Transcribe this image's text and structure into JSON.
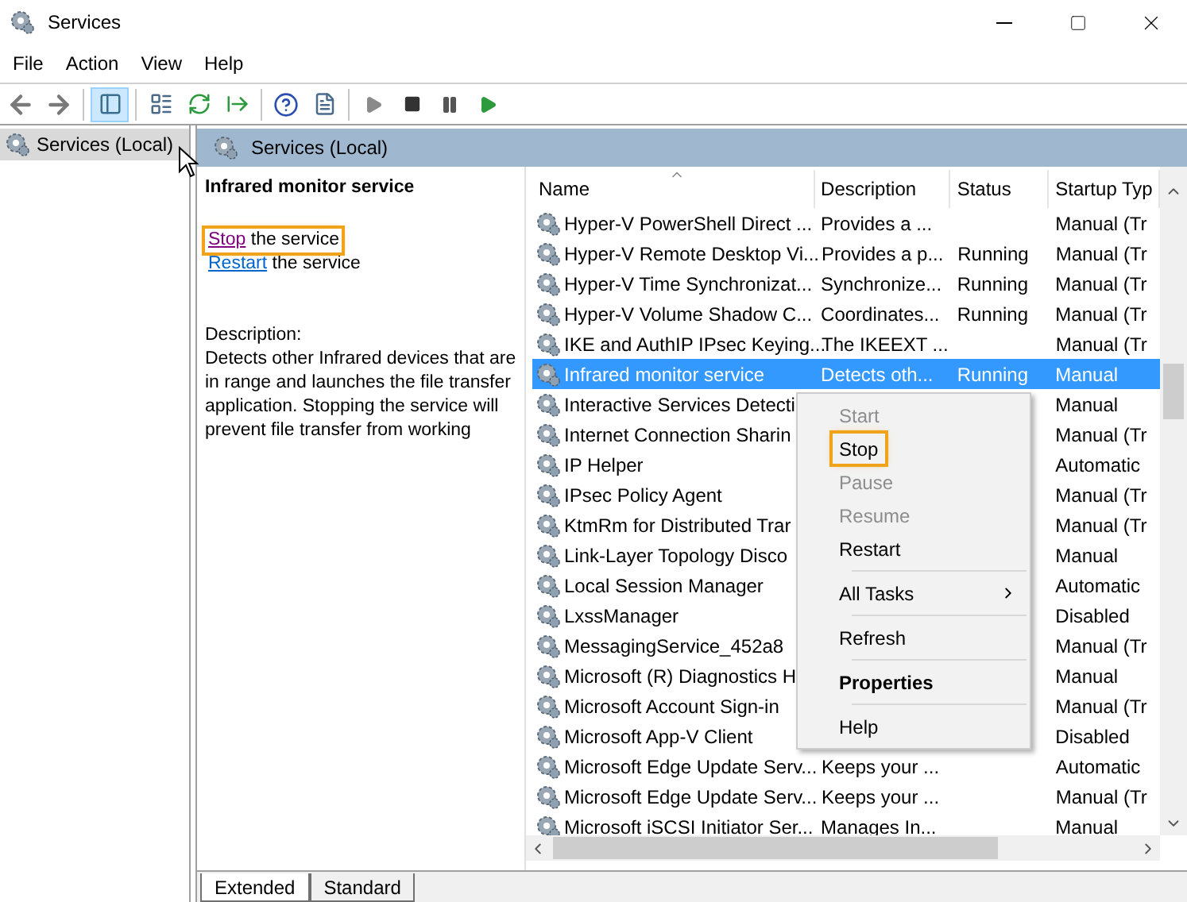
{
  "window": {
    "title": "Services"
  },
  "menu_bar": [
    "File",
    "Action",
    "View",
    "Help"
  ],
  "tree": {
    "items": [
      {
        "label": "Services (Local)",
        "selected": true
      }
    ]
  },
  "panel_header": "Services (Local)",
  "details": {
    "title": "Infrared monitor service",
    "actions": [
      {
        "link": "Stop",
        "rest": "the service",
        "highlighted": true
      },
      {
        "link": "Restart",
        "rest": "the service",
        "highlighted": false
      }
    ],
    "description_label": "Description:",
    "description": "Detects other Infrared devices that are in range and launches the file transfer application. Stopping the service will prevent file transfer from working"
  },
  "table": {
    "columns": [
      "Name",
      "Description",
      "Status",
      "Startup Typ"
    ],
    "rows": [
      {
        "name": "Hyper-V PowerShell Direct ...",
        "description": "Provides a ...",
        "status": "",
        "startup": "Manual (Tr",
        "selected": false
      },
      {
        "name": "Hyper-V Remote Desktop Vi...",
        "description": "Provides a p...",
        "status": "Running",
        "startup": "Manual (Tr",
        "selected": false
      },
      {
        "name": "Hyper-V Time Synchronizat...",
        "description": "Synchronize...",
        "status": "Running",
        "startup": "Manual (Tr",
        "selected": false
      },
      {
        "name": "Hyper-V Volume Shadow C...",
        "description": "Coordinates...",
        "status": "Running",
        "startup": "Manual (Tr",
        "selected": false
      },
      {
        "name": "IKE and AuthIP IPsec Keying...",
        "description": "The IKEEXT ...",
        "status": "",
        "startup": "Manual (Tr",
        "selected": false
      },
      {
        "name": "Infrared monitor service",
        "description": "Detects oth...",
        "status": "Running",
        "startup": "Manual",
        "selected": true
      },
      {
        "name": "Interactive Services Detecti",
        "description": "",
        "status": "",
        "startup": "Manual",
        "selected": false
      },
      {
        "name": "Internet Connection Sharin",
        "description": "",
        "status": "",
        "startup": "Manual (Tr",
        "selected": false
      },
      {
        "name": "IP Helper",
        "description": "",
        "status": "",
        "startup": "Automatic",
        "selected": false
      },
      {
        "name": "IPsec Policy Agent",
        "description": "",
        "status": "",
        "startup": "Manual (Tr",
        "selected": false
      },
      {
        "name": "KtmRm for Distributed Trar",
        "description": "",
        "status": "",
        "startup": "Manual (Tr",
        "selected": false
      },
      {
        "name": "Link-Layer Topology Disco",
        "description": "",
        "status": "",
        "startup": "Manual",
        "selected": false
      },
      {
        "name": "Local Session Manager",
        "description": "",
        "status": "",
        "startup": "Automatic",
        "selected": false
      },
      {
        "name": "LxssManager",
        "description": "",
        "status": "",
        "startup": "Disabled",
        "selected": false
      },
      {
        "name": "MessagingService_452a8",
        "description": "",
        "status": "",
        "startup": "Manual (Tr",
        "selected": false
      },
      {
        "name": "Microsoft (R) Diagnostics H",
        "description": "",
        "status": "",
        "startup": "Manual",
        "selected": false
      },
      {
        "name": "Microsoft Account Sign-in",
        "description": "",
        "status": "",
        "startup": "Manual (Tr",
        "selected": false
      },
      {
        "name": "Microsoft App-V Client",
        "description": "",
        "status": "",
        "startup": "Disabled",
        "selected": false
      },
      {
        "name": "Microsoft Edge Update Serv...",
        "description": "Keeps your ...",
        "status": "",
        "startup": "Automatic",
        "selected": false
      },
      {
        "name": "Microsoft Edge Update Serv...",
        "description": "Keeps your ...",
        "status": "",
        "startup": "Manual (Tr",
        "selected": false
      },
      {
        "name": "Microsoft iSCSI Initiator Ser...",
        "description": "Manages In...",
        "status": "",
        "startup": "Manual",
        "selected": false
      }
    ]
  },
  "context_menu": {
    "items": [
      {
        "kind": "item",
        "label": "Start",
        "disabled": true,
        "highlighted": false,
        "bold": false
      },
      {
        "kind": "item",
        "label": "Stop",
        "disabled": false,
        "highlighted": true,
        "bold": false
      },
      {
        "kind": "item",
        "label": "Pause",
        "disabled": true,
        "highlighted": false,
        "bold": false
      },
      {
        "kind": "item",
        "label": "Resume",
        "disabled": true,
        "highlighted": false,
        "bold": false
      },
      {
        "kind": "item",
        "label": "Restart",
        "disabled": false,
        "highlighted": false,
        "bold": false
      },
      {
        "kind": "separator"
      },
      {
        "kind": "submenu",
        "label": "All Tasks",
        "disabled": false,
        "highlighted": false,
        "bold": false
      },
      {
        "kind": "separator"
      },
      {
        "kind": "item",
        "label": "Refresh",
        "disabled": false,
        "highlighted": false,
        "bold": false
      },
      {
        "kind": "separator"
      },
      {
        "kind": "item",
        "label": "Properties",
        "disabled": false,
        "highlighted": false,
        "bold": true
      },
      {
        "kind": "separator"
      },
      {
        "kind": "item",
        "label": "Help",
        "disabled": false,
        "highlighted": false,
        "bold": false
      }
    ]
  },
  "view_tabs": [
    {
      "label": "Extended",
      "selected": true
    },
    {
      "label": "Standard",
      "selected": false
    }
  ]
}
